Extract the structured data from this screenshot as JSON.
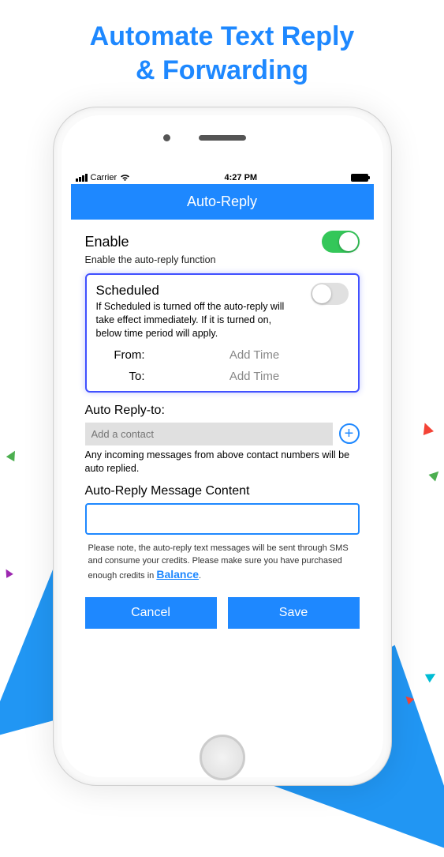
{
  "promo": {
    "line1": "Automate Text Reply",
    "line2": "&  Forwarding"
  },
  "status_bar": {
    "carrier": "Carrier",
    "time": "4:27 PM"
  },
  "header": {
    "title": "Auto-Reply"
  },
  "enable": {
    "label": "Enable",
    "sublabel": "Enable the auto-reply function",
    "value": true
  },
  "scheduled": {
    "title": "Scheduled",
    "desc": "If Scheduled is turned off the auto-reply will take effect immediately. If it is turned on, below time period will apply.",
    "value": false,
    "from_label": "From:",
    "from_value": "Add Time",
    "to_label": "To:",
    "to_value": "Add Time"
  },
  "reply_to": {
    "title": "Auto Reply-to:",
    "placeholder": "Add a contact",
    "info": "Any incoming messages from above contact numbers will be auto replied."
  },
  "message": {
    "title": "Auto-Reply Message Content",
    "value": ""
  },
  "note": {
    "text": "Please note, the auto-reply text messages will be sent through SMS and consume your credits. Please make sure you have purchased enough credits in ",
    "link": "Balance",
    "suffix": "."
  },
  "buttons": {
    "cancel": "Cancel",
    "save": "Save"
  }
}
